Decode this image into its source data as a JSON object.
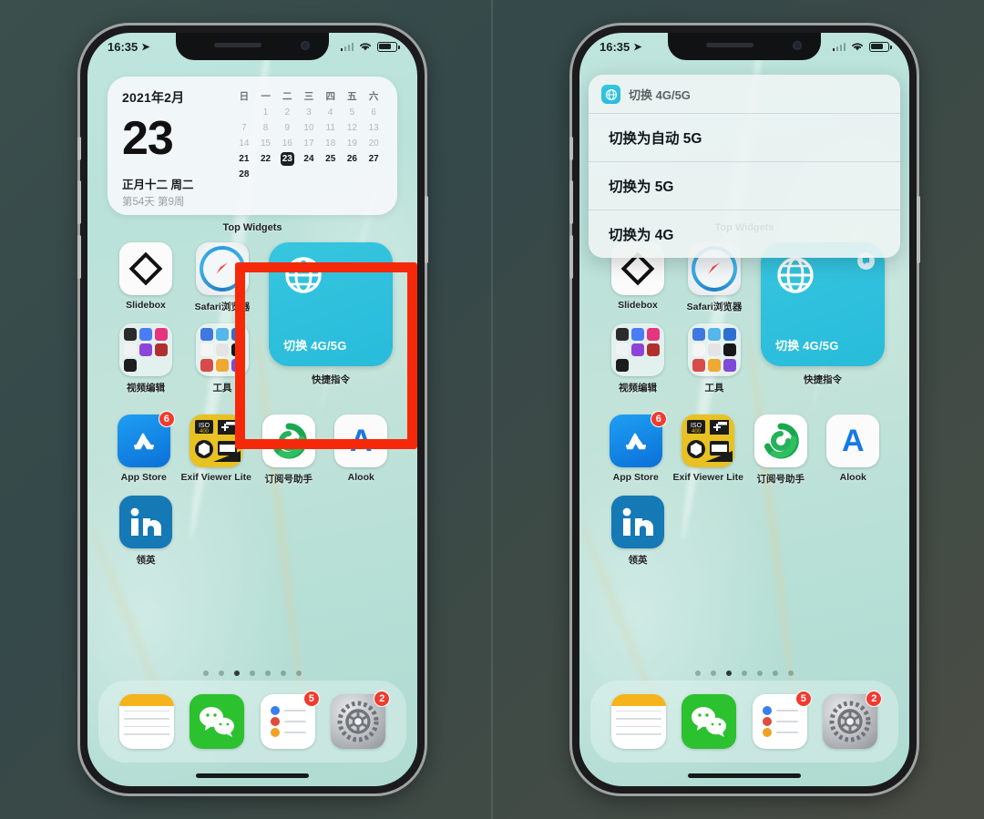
{
  "status_bar": {
    "time": "16:35",
    "location_icon": "location-arrow-icon",
    "wifi_icon": "wifi-icon",
    "battery_icon": "battery-icon"
  },
  "calendar_widget": {
    "month_title": "2021年2月",
    "day_number": "23",
    "lunar": "正月十二  周二",
    "sub": "第54天  第9周",
    "weekday_headers": [
      "日",
      "一",
      "二",
      "三",
      "四",
      "五",
      "六"
    ],
    "weeks": [
      [
        "",
        "1",
        "2",
        "3",
        "4",
        "5",
        "6"
      ],
      [
        "7",
        "8",
        "9",
        "10",
        "11",
        "12",
        "13"
      ],
      [
        "14",
        "15",
        "16",
        "17",
        "18",
        "19",
        "20"
      ],
      [
        "21",
        "22",
        "23",
        "24",
        "25",
        "26",
        "27"
      ],
      [
        "28",
        "",
        "",
        "",
        "",
        "",
        ""
      ]
    ],
    "today": "23"
  },
  "top_widgets_label": "Top Widgets",
  "shortcut_widget": {
    "icon": "globe-icon",
    "text": "切换 4G/5G",
    "label": "快捷指令",
    "badge_icon": "shortcut-run-badge-icon",
    "color": "#2ec0dd"
  },
  "apps_row1": [
    {
      "name": "Slidebox",
      "icon": "slidebox-icon"
    },
    {
      "name": "Safari浏览器",
      "icon": "safari-icon"
    }
  ],
  "apps_row2": [
    {
      "name": "视频编辑",
      "icon": "folder-icon"
    },
    {
      "name": "工具",
      "icon": "folder-icon"
    }
  ],
  "apps_row3": [
    {
      "name": "App Store",
      "icon": "app-store-icon",
      "badge": "6"
    },
    {
      "name": "Exif Viewer Lite",
      "icon": "exif-viewer-icon",
      "badge": ""
    },
    {
      "name": "订阅号助手",
      "icon": "wechat-subscription-icon",
      "badge": ""
    },
    {
      "name": "Alook",
      "icon": "alook-icon",
      "badge": ""
    }
  ],
  "apps_row4": [
    {
      "name": "领英",
      "icon": "linkedin-icon",
      "badge": ""
    }
  ],
  "dock": [
    {
      "name": "备忘录",
      "icon": "notes-icon",
      "badge": ""
    },
    {
      "name": "微信",
      "icon": "wechat-icon",
      "badge": ""
    },
    {
      "name": "提醒事项",
      "icon": "reminders-icon",
      "badge": "5"
    },
    {
      "name": "设置",
      "icon": "settings-icon",
      "badge": "2"
    }
  ],
  "page_dots": {
    "count": 7,
    "active_index": 2
  },
  "popup": {
    "header_icon": "globe-icon",
    "header_title": "切换 4G/5G",
    "items": [
      "切换为自动 5G",
      "切换为 5G",
      "切换为 4G"
    ]
  },
  "highlight": {
    "color": "#f5290a"
  }
}
